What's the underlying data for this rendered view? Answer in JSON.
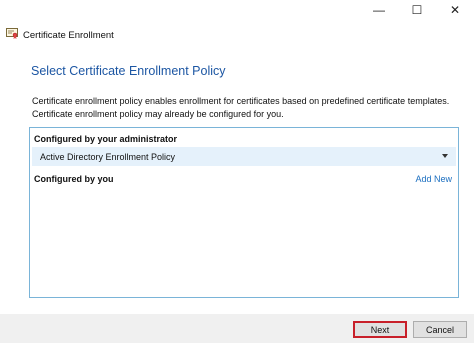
{
  "window": {
    "title": "Certificate Enrollment",
    "controls": {
      "minimize": "—",
      "maximize": "☐",
      "close": "✕"
    }
  },
  "page": {
    "heading": "Select Certificate Enrollment Policy",
    "description_line1": "Certificate enrollment policy enables enrollment for certificates based on predefined certificate templates.",
    "description_line2": "Certificate enrollment policy may already be configured for you."
  },
  "policies": {
    "admin_header": "Configured by your administrator",
    "admin_policy": "Active Directory Enrollment Policy",
    "user_header": "Configured by you",
    "add_new": "Add New"
  },
  "buttons": {
    "next": "Next",
    "cancel": "Cancel"
  },
  "colors": {
    "heading": "#1c56a3",
    "link": "#1c6fc0",
    "highlight": "#c8202a"
  },
  "icons": {
    "window_icon": "certificate-icon",
    "expand": "chevron-down-icon"
  }
}
